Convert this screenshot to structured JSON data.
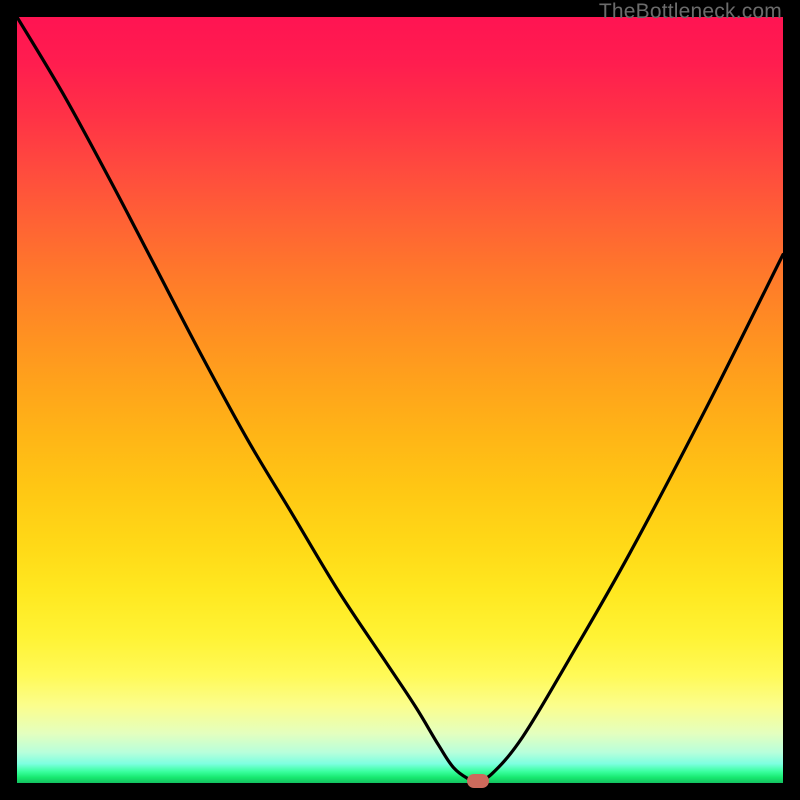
{
  "watermark": "TheBottleneck.com",
  "chart_data": {
    "type": "line",
    "title": "",
    "xlabel": "",
    "ylabel": "",
    "xlim": [
      0,
      100
    ],
    "ylim": [
      0,
      100
    ],
    "grid": false,
    "series": [
      {
        "name": "bottleneck-curve",
        "x": [
          0,
          6,
          12,
          18,
          24,
          30,
          36,
          42,
          48,
          52,
          55,
          57,
          59,
          60,
          62,
          66,
          72,
          80,
          90,
          100
        ],
        "values": [
          100,
          90,
          79,
          67.5,
          56,
          45,
          35,
          25,
          16,
          10,
          5,
          2,
          0.5,
          0.3,
          1.2,
          6,
          16,
          30,
          49,
          69
        ]
      }
    ],
    "marker": {
      "x": 60.2,
      "y": 0.3
    },
    "background_gradient": {
      "direction": "vertical",
      "stops": [
        {
          "pos": 0.0,
          "color": "#ff1452"
        },
        {
          "pos": 0.5,
          "color": "#ffa61b"
        },
        {
          "pos": 0.8,
          "color": "#fff132"
        },
        {
          "pos": 0.95,
          "color": "#c8ffc9"
        },
        {
          "pos": 1.0,
          "color": "#14c060"
        }
      ]
    }
  }
}
